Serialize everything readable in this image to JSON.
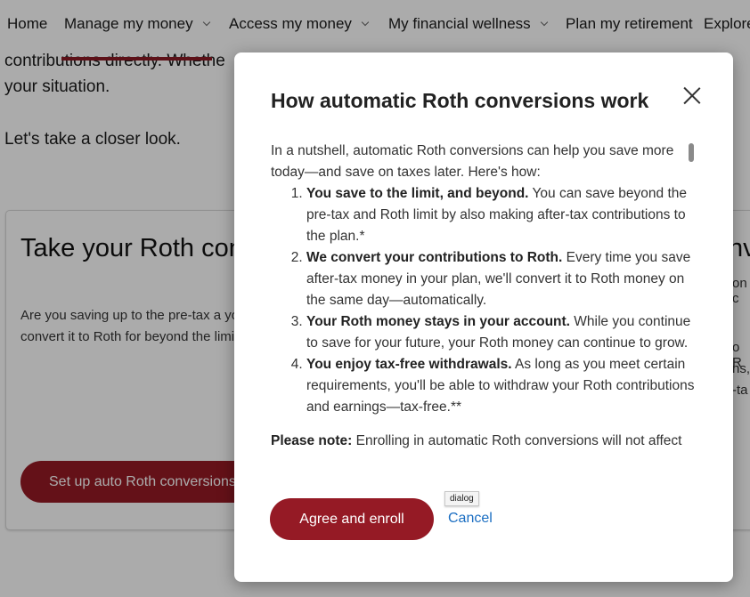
{
  "nav": {
    "items": [
      {
        "label": "Home",
        "has_dropdown": false
      },
      {
        "label": "Manage my money",
        "has_dropdown": true,
        "active": true
      },
      {
        "label": "Access my money",
        "has_dropdown": true
      },
      {
        "label": "My financial wellness",
        "has_dropdown": true
      },
      {
        "label": "Plan my retirement",
        "has_dropdown": false
      },
      {
        "label": "Explore",
        "has_dropdown": false
      }
    ]
  },
  "page": {
    "intro_line1": "contributions directly. Whethe",
    "intro_line2": "your situation.",
    "intro_line3": "Let's take a closer look."
  },
  "card": {
    "title": "Take your Roth con beyond the limit",
    "body": "Are you saving up to the pre-tax a your savings by contributing traditi automatically convert it to Roth for beyond the limit—and get all the b",
    "button_label": "Set up auto Roth conversions"
  },
  "card2": {
    "title_fragment": "nv",
    "line1": "on c",
    "line2": "o R",
    "line3": "ns,",
    "line4": "-ta"
  },
  "dialog": {
    "title": "How automatic Roth conversions work",
    "intro": "In a nutshell, automatic Roth conversions can help you save more today—and save on taxes later. Here's how:",
    "steps": [
      {
        "bold": "You save to the limit, and beyond.",
        "text": " You can save beyond the pre-tax and Roth limit by also making after-tax contributions to the plan.*"
      },
      {
        "bold": "We convert your contributions to Roth.",
        "text": " Every time you save after-tax money in your plan, we'll convert it to Roth money on the same day—automatically."
      },
      {
        "bold": "Your Roth money stays in your account.",
        "text": " While you continue to save for your future, your Roth money can continue to grow."
      },
      {
        "bold": "You enjoy tax-free withdrawals.",
        "text": " As long as you meet certain requirements, you'll be able to withdraw your Roth contributions and earnings—tax-free.**"
      }
    ],
    "note_bold": "Please note:",
    "note_text": " Enrolling in automatic Roth conversions will not affect",
    "agree_label": "Agree and enroll",
    "cancel_label": "Cancel",
    "tooltip": "dialog"
  },
  "colors": {
    "brand_red": "#951a25",
    "link_blue": "#1b6ec2"
  }
}
